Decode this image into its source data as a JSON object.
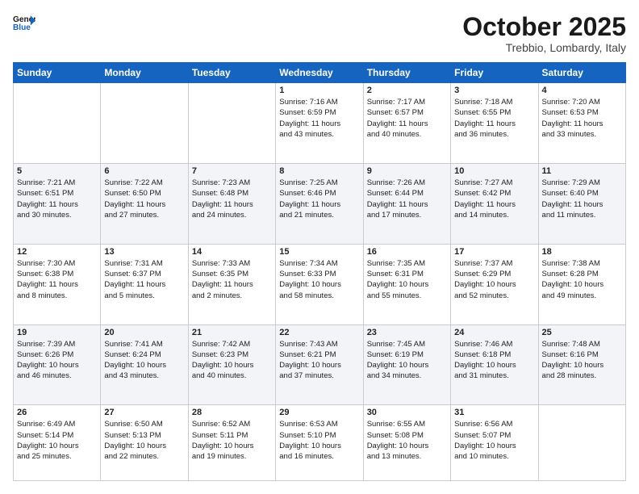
{
  "header": {
    "logo_general": "General",
    "logo_blue": "Blue",
    "month": "October 2025",
    "location": "Trebbio, Lombardy, Italy"
  },
  "weekdays": [
    "Sunday",
    "Monday",
    "Tuesday",
    "Wednesday",
    "Thursday",
    "Friday",
    "Saturday"
  ],
  "weeks": [
    [
      {
        "day": "",
        "info": ""
      },
      {
        "day": "",
        "info": ""
      },
      {
        "day": "",
        "info": ""
      },
      {
        "day": "1",
        "info": "Sunrise: 7:16 AM\nSunset: 6:59 PM\nDaylight: 11 hours\nand 43 minutes."
      },
      {
        "day": "2",
        "info": "Sunrise: 7:17 AM\nSunset: 6:57 PM\nDaylight: 11 hours\nand 40 minutes."
      },
      {
        "day": "3",
        "info": "Sunrise: 7:18 AM\nSunset: 6:55 PM\nDaylight: 11 hours\nand 36 minutes."
      },
      {
        "day": "4",
        "info": "Sunrise: 7:20 AM\nSunset: 6:53 PM\nDaylight: 11 hours\nand 33 minutes."
      }
    ],
    [
      {
        "day": "5",
        "info": "Sunrise: 7:21 AM\nSunset: 6:51 PM\nDaylight: 11 hours\nand 30 minutes."
      },
      {
        "day": "6",
        "info": "Sunrise: 7:22 AM\nSunset: 6:50 PM\nDaylight: 11 hours\nand 27 minutes."
      },
      {
        "day": "7",
        "info": "Sunrise: 7:23 AM\nSunset: 6:48 PM\nDaylight: 11 hours\nand 24 minutes."
      },
      {
        "day": "8",
        "info": "Sunrise: 7:25 AM\nSunset: 6:46 PM\nDaylight: 11 hours\nand 21 minutes."
      },
      {
        "day": "9",
        "info": "Sunrise: 7:26 AM\nSunset: 6:44 PM\nDaylight: 11 hours\nand 17 minutes."
      },
      {
        "day": "10",
        "info": "Sunrise: 7:27 AM\nSunset: 6:42 PM\nDaylight: 11 hours\nand 14 minutes."
      },
      {
        "day": "11",
        "info": "Sunrise: 7:29 AM\nSunset: 6:40 PM\nDaylight: 11 hours\nand 11 minutes."
      }
    ],
    [
      {
        "day": "12",
        "info": "Sunrise: 7:30 AM\nSunset: 6:38 PM\nDaylight: 11 hours\nand 8 minutes."
      },
      {
        "day": "13",
        "info": "Sunrise: 7:31 AM\nSunset: 6:37 PM\nDaylight: 11 hours\nand 5 minutes."
      },
      {
        "day": "14",
        "info": "Sunrise: 7:33 AM\nSunset: 6:35 PM\nDaylight: 11 hours\nand 2 minutes."
      },
      {
        "day": "15",
        "info": "Sunrise: 7:34 AM\nSunset: 6:33 PM\nDaylight: 10 hours\nand 58 minutes."
      },
      {
        "day": "16",
        "info": "Sunrise: 7:35 AM\nSunset: 6:31 PM\nDaylight: 10 hours\nand 55 minutes."
      },
      {
        "day": "17",
        "info": "Sunrise: 7:37 AM\nSunset: 6:29 PM\nDaylight: 10 hours\nand 52 minutes."
      },
      {
        "day": "18",
        "info": "Sunrise: 7:38 AM\nSunset: 6:28 PM\nDaylight: 10 hours\nand 49 minutes."
      }
    ],
    [
      {
        "day": "19",
        "info": "Sunrise: 7:39 AM\nSunset: 6:26 PM\nDaylight: 10 hours\nand 46 minutes."
      },
      {
        "day": "20",
        "info": "Sunrise: 7:41 AM\nSunset: 6:24 PM\nDaylight: 10 hours\nand 43 minutes."
      },
      {
        "day": "21",
        "info": "Sunrise: 7:42 AM\nSunset: 6:23 PM\nDaylight: 10 hours\nand 40 minutes."
      },
      {
        "day": "22",
        "info": "Sunrise: 7:43 AM\nSunset: 6:21 PM\nDaylight: 10 hours\nand 37 minutes."
      },
      {
        "day": "23",
        "info": "Sunrise: 7:45 AM\nSunset: 6:19 PM\nDaylight: 10 hours\nand 34 minutes."
      },
      {
        "day": "24",
        "info": "Sunrise: 7:46 AM\nSunset: 6:18 PM\nDaylight: 10 hours\nand 31 minutes."
      },
      {
        "day": "25",
        "info": "Sunrise: 7:48 AM\nSunset: 6:16 PM\nDaylight: 10 hours\nand 28 minutes."
      }
    ],
    [
      {
        "day": "26",
        "info": "Sunrise: 6:49 AM\nSunset: 5:14 PM\nDaylight: 10 hours\nand 25 minutes."
      },
      {
        "day": "27",
        "info": "Sunrise: 6:50 AM\nSunset: 5:13 PM\nDaylight: 10 hours\nand 22 minutes."
      },
      {
        "day": "28",
        "info": "Sunrise: 6:52 AM\nSunset: 5:11 PM\nDaylight: 10 hours\nand 19 minutes."
      },
      {
        "day": "29",
        "info": "Sunrise: 6:53 AM\nSunset: 5:10 PM\nDaylight: 10 hours\nand 16 minutes."
      },
      {
        "day": "30",
        "info": "Sunrise: 6:55 AM\nSunset: 5:08 PM\nDaylight: 10 hours\nand 13 minutes."
      },
      {
        "day": "31",
        "info": "Sunrise: 6:56 AM\nSunset: 5:07 PM\nDaylight: 10 hours\nand 10 minutes."
      },
      {
        "day": "",
        "info": ""
      }
    ]
  ]
}
